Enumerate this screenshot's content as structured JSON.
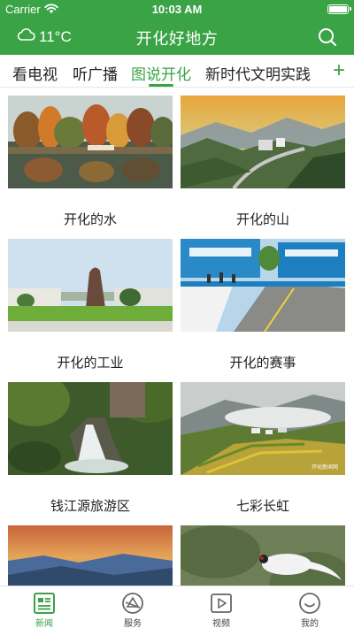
{
  "status_bar": {
    "carrier": "Carrier",
    "time": "10:03 AM"
  },
  "header": {
    "weather": "11°C",
    "title": "开化好地方"
  },
  "tabs": [
    {
      "label": "看电视"
    },
    {
      "label": "听广播"
    },
    {
      "label": "图说开化",
      "active": true
    },
    {
      "label": "新时代文明实践"
    }
  ],
  "add_tab": "+",
  "cards": [
    {
      "label": "开化的水"
    },
    {
      "label": "开化的山"
    },
    {
      "label": "开化的工业"
    },
    {
      "label": "开化的赛事"
    },
    {
      "label": "钱江源旅游区"
    },
    {
      "label": "七彩长虹"
    },
    {
      "label": ""
    },
    {
      "label": ""
    }
  ],
  "photo_text": {
    "watermark": "开化新闻网"
  },
  "bottom_nav": [
    {
      "label": "新闻",
      "icon": "news-icon",
      "active": true
    },
    {
      "label": "服务",
      "icon": "service-icon"
    },
    {
      "label": "视频",
      "icon": "video-icon"
    },
    {
      "label": "我的",
      "icon": "profile-icon"
    }
  ],
  "colors": {
    "brand": "#3aa345",
    "text": "#222222",
    "inactive_icon": "#666666"
  }
}
